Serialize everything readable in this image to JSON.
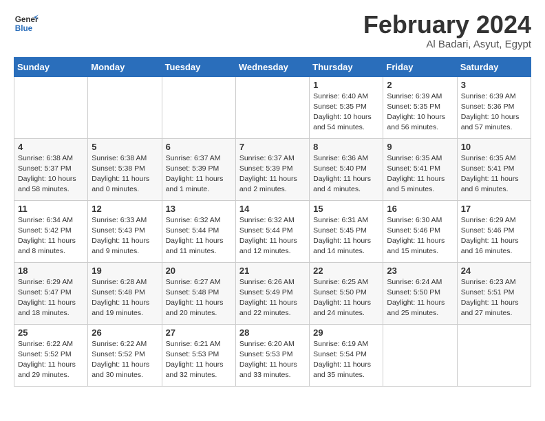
{
  "logo": {
    "line1": "General",
    "line2": "Blue"
  },
  "title": "February 2024",
  "subtitle": "Al Badari, Asyut, Egypt",
  "days_header": [
    "Sunday",
    "Monday",
    "Tuesday",
    "Wednesday",
    "Thursday",
    "Friday",
    "Saturday"
  ],
  "weeks": [
    [
      {
        "day": "",
        "info": ""
      },
      {
        "day": "",
        "info": ""
      },
      {
        "day": "",
        "info": ""
      },
      {
        "day": "",
        "info": ""
      },
      {
        "day": "1",
        "info": "Sunrise: 6:40 AM\nSunset: 5:35 PM\nDaylight: 10 hours and 54 minutes."
      },
      {
        "day": "2",
        "info": "Sunrise: 6:39 AM\nSunset: 5:35 PM\nDaylight: 10 hours and 56 minutes."
      },
      {
        "day": "3",
        "info": "Sunrise: 6:39 AM\nSunset: 5:36 PM\nDaylight: 10 hours and 57 minutes."
      }
    ],
    [
      {
        "day": "4",
        "info": "Sunrise: 6:38 AM\nSunset: 5:37 PM\nDaylight: 10 hours and 58 minutes."
      },
      {
        "day": "5",
        "info": "Sunrise: 6:38 AM\nSunset: 5:38 PM\nDaylight: 11 hours and 0 minutes."
      },
      {
        "day": "6",
        "info": "Sunrise: 6:37 AM\nSunset: 5:39 PM\nDaylight: 11 hours and 1 minute."
      },
      {
        "day": "7",
        "info": "Sunrise: 6:37 AM\nSunset: 5:39 PM\nDaylight: 11 hours and 2 minutes."
      },
      {
        "day": "8",
        "info": "Sunrise: 6:36 AM\nSunset: 5:40 PM\nDaylight: 11 hours and 4 minutes."
      },
      {
        "day": "9",
        "info": "Sunrise: 6:35 AM\nSunset: 5:41 PM\nDaylight: 11 hours and 5 minutes."
      },
      {
        "day": "10",
        "info": "Sunrise: 6:35 AM\nSunset: 5:41 PM\nDaylight: 11 hours and 6 minutes."
      }
    ],
    [
      {
        "day": "11",
        "info": "Sunrise: 6:34 AM\nSunset: 5:42 PM\nDaylight: 11 hours and 8 minutes."
      },
      {
        "day": "12",
        "info": "Sunrise: 6:33 AM\nSunset: 5:43 PM\nDaylight: 11 hours and 9 minutes."
      },
      {
        "day": "13",
        "info": "Sunrise: 6:32 AM\nSunset: 5:44 PM\nDaylight: 11 hours and 11 minutes."
      },
      {
        "day": "14",
        "info": "Sunrise: 6:32 AM\nSunset: 5:44 PM\nDaylight: 11 hours and 12 minutes."
      },
      {
        "day": "15",
        "info": "Sunrise: 6:31 AM\nSunset: 5:45 PM\nDaylight: 11 hours and 14 minutes."
      },
      {
        "day": "16",
        "info": "Sunrise: 6:30 AM\nSunset: 5:46 PM\nDaylight: 11 hours and 15 minutes."
      },
      {
        "day": "17",
        "info": "Sunrise: 6:29 AM\nSunset: 5:46 PM\nDaylight: 11 hours and 16 minutes."
      }
    ],
    [
      {
        "day": "18",
        "info": "Sunrise: 6:29 AM\nSunset: 5:47 PM\nDaylight: 11 hours and 18 minutes."
      },
      {
        "day": "19",
        "info": "Sunrise: 6:28 AM\nSunset: 5:48 PM\nDaylight: 11 hours and 19 minutes."
      },
      {
        "day": "20",
        "info": "Sunrise: 6:27 AM\nSunset: 5:48 PM\nDaylight: 11 hours and 20 minutes."
      },
      {
        "day": "21",
        "info": "Sunrise: 6:26 AM\nSunset: 5:49 PM\nDaylight: 11 hours and 22 minutes."
      },
      {
        "day": "22",
        "info": "Sunrise: 6:25 AM\nSunset: 5:50 PM\nDaylight: 11 hours and 24 minutes."
      },
      {
        "day": "23",
        "info": "Sunrise: 6:24 AM\nSunset: 5:50 PM\nDaylight: 11 hours and 25 minutes."
      },
      {
        "day": "24",
        "info": "Sunrise: 6:23 AM\nSunset: 5:51 PM\nDaylight: 11 hours and 27 minutes."
      }
    ],
    [
      {
        "day": "25",
        "info": "Sunrise: 6:22 AM\nSunset: 5:52 PM\nDaylight: 11 hours and 29 minutes."
      },
      {
        "day": "26",
        "info": "Sunrise: 6:22 AM\nSunset: 5:52 PM\nDaylight: 11 hours and 30 minutes."
      },
      {
        "day": "27",
        "info": "Sunrise: 6:21 AM\nSunset: 5:53 PM\nDaylight: 11 hours and 32 minutes."
      },
      {
        "day": "28",
        "info": "Sunrise: 6:20 AM\nSunset: 5:53 PM\nDaylight: 11 hours and 33 minutes."
      },
      {
        "day": "29",
        "info": "Sunrise: 6:19 AM\nSunset: 5:54 PM\nDaylight: 11 hours and 35 minutes."
      },
      {
        "day": "",
        "info": ""
      },
      {
        "day": "",
        "info": ""
      }
    ]
  ]
}
